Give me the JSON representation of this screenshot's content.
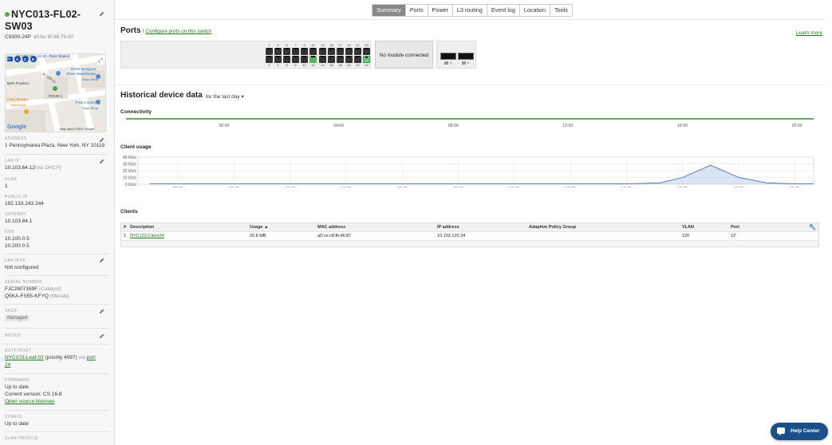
{
  "device": {
    "name_line1": "NYC013-FL02-",
    "name_line2": "SW03",
    "model": "C9300-24P",
    "mac": "a0:bc:6f:d6:7b:00",
    "status_color": "#47b347"
  },
  "map": {
    "labels": [
      "W 34th St",
      "34 St - Penn Station",
      "DSW Designer",
      "Shoe Warehouse",
      "Shoe Shop",
      "Betz Pavilion",
      "W 34th st",
      "PENN 1",
      "Daily Burger",
      "Hamburger",
      "Foot Locker",
      "Shoe Shop",
      "Google",
      "Map data ©2024 Google"
    ],
    "transit_letters": [
      "A",
      "C",
      "E"
    ],
    "badge": "34"
  },
  "sidebar": {
    "address_label": "ADDRESS",
    "address": "1 Pennsylvania Plaza, New York, NY 10119",
    "lan_ip_label": "LAN IP",
    "lan_ip": "10.103.64.12",
    "lan_ip_sub": "(via DHCP)",
    "vlan_label": "VLAN",
    "vlan": "1",
    "public_ip_label": "PUBLIC IP",
    "public_ip": "192.133.243.244",
    "gateway_label": "GATEWAY",
    "gateway": "10.103.64.1",
    "dns_label": "DNS",
    "dns1": "10.100.0.5",
    "dns2": "10.200.0.5",
    "lan_ipv6_label": "LAN IPV6",
    "lan_ipv6": "Not configured",
    "serial_label": "SERIAL NUMBER",
    "serial1": "FJC2807169F",
    "serial1_sub": "(Catalyst)",
    "serial2": "Q5KA-FS55-KFYQ",
    "serial2_sub": "(Meraki)",
    "tags_label": "TAGS",
    "tag": "Managed",
    "notes_label": "NOTES",
    "rstp_label": "RSTP ROOT",
    "rstp_link": "NYC103-Leaf-02",
    "rstp_text": " (priority 4097) ",
    "rstp_via": "via ",
    "rstp_port_link": "port",
    "rstp_port_num": "24",
    "firmware_label": "FIRMWARE",
    "firmware_status": "Up to date",
    "firmware_version": "Current version: CS 16.8",
    "firmware_link": "Open source licenses",
    "config_label": "CONFIG",
    "config_status": "Up to date",
    "vlan_profile_label": "VLAN PROFILE"
  },
  "tabs": [
    "Summary",
    "Ports",
    "Power",
    "L3 routing",
    "Event log",
    "Location",
    "Tools"
  ],
  "active_tab": "Summary",
  "ports": {
    "title": "Ports",
    "slash": "/",
    "configure_link": "Configure ports on this switch",
    "learn_more": "Learn more",
    "top_numbers": [
      "1",
      "3",
      "5",
      "7",
      "9",
      "11",
      "13",
      "15",
      "17",
      "19",
      "21",
      "23"
    ],
    "bottom_numbers": [
      "2",
      "4",
      "6",
      "8",
      "10",
      "12",
      "14",
      "16",
      "18",
      "20",
      "22",
      "24"
    ],
    "up_ports": [
      12,
      24
    ],
    "module_text": "No module connected",
    "sfp_numbers": [
      "1",
      "2"
    ],
    "up_color": "#5cb35c"
  },
  "history": {
    "title": "Historical device data",
    "range": "for the last day",
    "connectivity_label": "Connectivity",
    "connectivity_times": [
      "00:00",
      "04:00",
      "08:00",
      "12:00",
      "16:00",
      "20:00"
    ],
    "connectivity_color": "#5cb35c",
    "client_usage_label": "Client usage"
  },
  "chart_data": {
    "type": "area",
    "title": "Client usage",
    "x": [
      "22:00",
      "00:00",
      "02:00",
      "04:00",
      "06:00",
      "08:00",
      "10:00",
      "12:00",
      "14:00",
      "16:00",
      "18:00",
      "20:00"
    ],
    "yticks": [
      "0 Kb/s",
      "10 Kb/s",
      "20 Kb/s",
      "30 Kb/s",
      "40 Kb/s"
    ],
    "ylim": [
      0,
      40
    ],
    "series": [
      {
        "values_x_hours": [
          -3,
          -2,
          0,
          2,
          4,
          6,
          8,
          10,
          12,
          14,
          15.2,
          16,
          17,
          18,
          19,
          20,
          21.5
        ],
        "values": [
          0.5,
          0.5,
          0.5,
          0.5,
          0.5,
          0.5,
          0.5,
          0.5,
          0.5,
          0.5,
          2,
          10,
          28,
          10,
          2,
          0.5,
          0.5
        ]
      }
    ],
    "color": "#3a6fc4",
    "grid": true
  },
  "clients": {
    "title": "Clients",
    "columns": [
      "#",
      "Description",
      "Usage ▲",
      "MAC address",
      "IP address",
      "Adaptive Policy Group",
      "VLAN",
      "Port"
    ],
    "rows": [
      [
        "1",
        "NYC103-Client34",
        "20.8 MB",
        "a0:ce:c8:fb:46:87",
        "10.103.120.34",
        "",
        "120",
        "12"
      ]
    ]
  },
  "help_center": "Help Center"
}
